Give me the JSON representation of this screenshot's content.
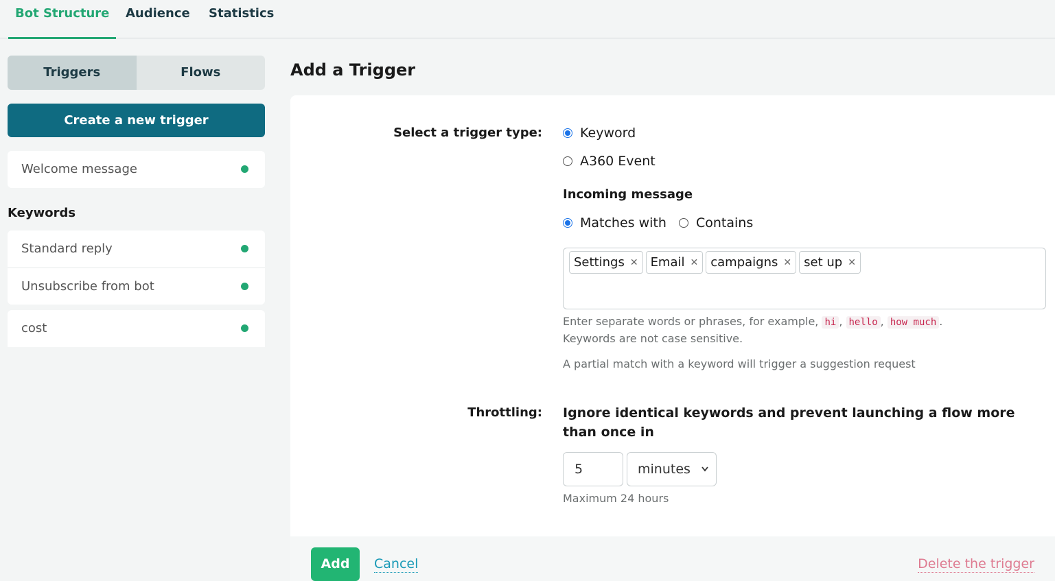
{
  "nav": {
    "tabs": [
      {
        "label": "Bot Structure",
        "active": true
      },
      {
        "label": "Audience",
        "active": false
      },
      {
        "label": "Statistics",
        "active": false
      }
    ]
  },
  "sidebar": {
    "segments": [
      {
        "label": "Triggers",
        "active": true
      },
      {
        "label": "Flows",
        "active": false
      }
    ],
    "create_button": "Create a new trigger",
    "welcome": {
      "label": "Welcome message",
      "status": "active"
    },
    "keywords_heading": "Keywords",
    "keyword_items": [
      {
        "label": "Standard reply",
        "status": "active"
      },
      {
        "label": "Unsubscribe from bot",
        "status": "active"
      }
    ],
    "extra_item": {
      "label": "cost",
      "status": "active"
    }
  },
  "main": {
    "title": "Add a Trigger",
    "trigger_type_label": "Select a trigger type:",
    "trigger_types": [
      {
        "label": "Keyword",
        "checked": true
      },
      {
        "label": "A360 Event",
        "checked": false
      }
    ],
    "incoming_heading": "Incoming message",
    "match_modes": [
      {
        "label": "Matches with",
        "checked": true
      },
      {
        "label": "Contains",
        "checked": false
      }
    ],
    "keyword_tags": [
      "Settings",
      "Email",
      "campaigns",
      "set up"
    ],
    "hint_line1_prefix": "Enter separate words or phrases, for example,",
    "hint_examples": [
      "hi",
      "hello",
      "how much"
    ],
    "hint_line2": "Keywords are not case sensitive.",
    "hint_line3": "A partial match with a keyword will trigger a suggestion request",
    "throttling_label": "Throttling:",
    "throttling_text": "Ignore identical keywords and prevent launching a flow more than once in",
    "throttle_value": "5",
    "throttle_unit": "minutes",
    "throttle_hint": "Maximum 24 hours"
  },
  "footer": {
    "add": "Add",
    "cancel": "Cancel",
    "delete": "Delete the trigger"
  },
  "colors": {
    "accent_green": "#22a773",
    "primary_teal": "#0f6b81",
    "link_blue": "#1899b6",
    "danger_pink": "#de7b91",
    "radio_blue": "#1a73e8"
  }
}
